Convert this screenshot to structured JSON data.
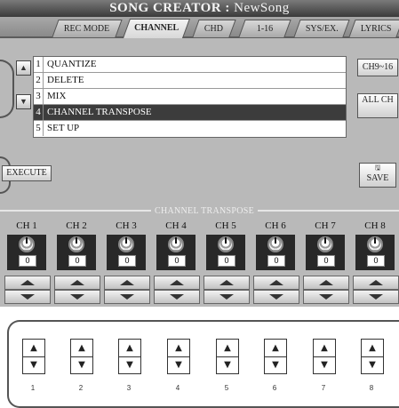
{
  "title": {
    "prefix": "SONG CREATOR",
    "separator": " : ",
    "song": "NewSong"
  },
  "tabs": [
    {
      "label": "REC MODE"
    },
    {
      "label": "CHANNEL",
      "active": true
    },
    {
      "label": "CHD"
    },
    {
      "label": "1-16"
    },
    {
      "label": "SYS/EX."
    },
    {
      "label": "LYRICS"
    }
  ],
  "list": {
    "items": [
      {
        "num": "1",
        "label": "QUANTIZE"
      },
      {
        "num": "2",
        "label": "DELETE"
      },
      {
        "num": "3",
        "label": "MIX"
      },
      {
        "num": "4",
        "label": "CHANNEL TRANSPOSE",
        "selected": true
      },
      {
        "num": "5",
        "label": "SET UP"
      }
    ],
    "up_icon": "up-triangle-icon",
    "down_icon": "down-triangle-icon"
  },
  "buttons": {
    "ch_range": "CH9~16",
    "all_ch": "ALL CH",
    "execute": "EXECUTE",
    "save": "SAVE"
  },
  "section": {
    "label": "CHANNEL TRANSPOSE"
  },
  "channels": [
    {
      "label": "CH 1",
      "value": "0"
    },
    {
      "label": "CH 2",
      "value": "0"
    },
    {
      "label": "CH 3",
      "value": "0"
    },
    {
      "label": "CH 4",
      "value": "0"
    },
    {
      "label": "CH 5",
      "value": "0"
    },
    {
      "label": "CH 6",
      "value": "0"
    },
    {
      "label": "CH 7",
      "value": "0"
    },
    {
      "label": "CH 8",
      "value": "0"
    }
  ],
  "hardware": {
    "up_glyph": "▲",
    "down_glyph": "▼",
    "numbers": [
      "1",
      "2",
      "3",
      "4",
      "5",
      "6",
      "7",
      "8"
    ]
  },
  "colors": {
    "screen_bg": "#b9b9b9",
    "selected_row": "#3c3c3c",
    "title_bar": "#3a3a3a"
  }
}
